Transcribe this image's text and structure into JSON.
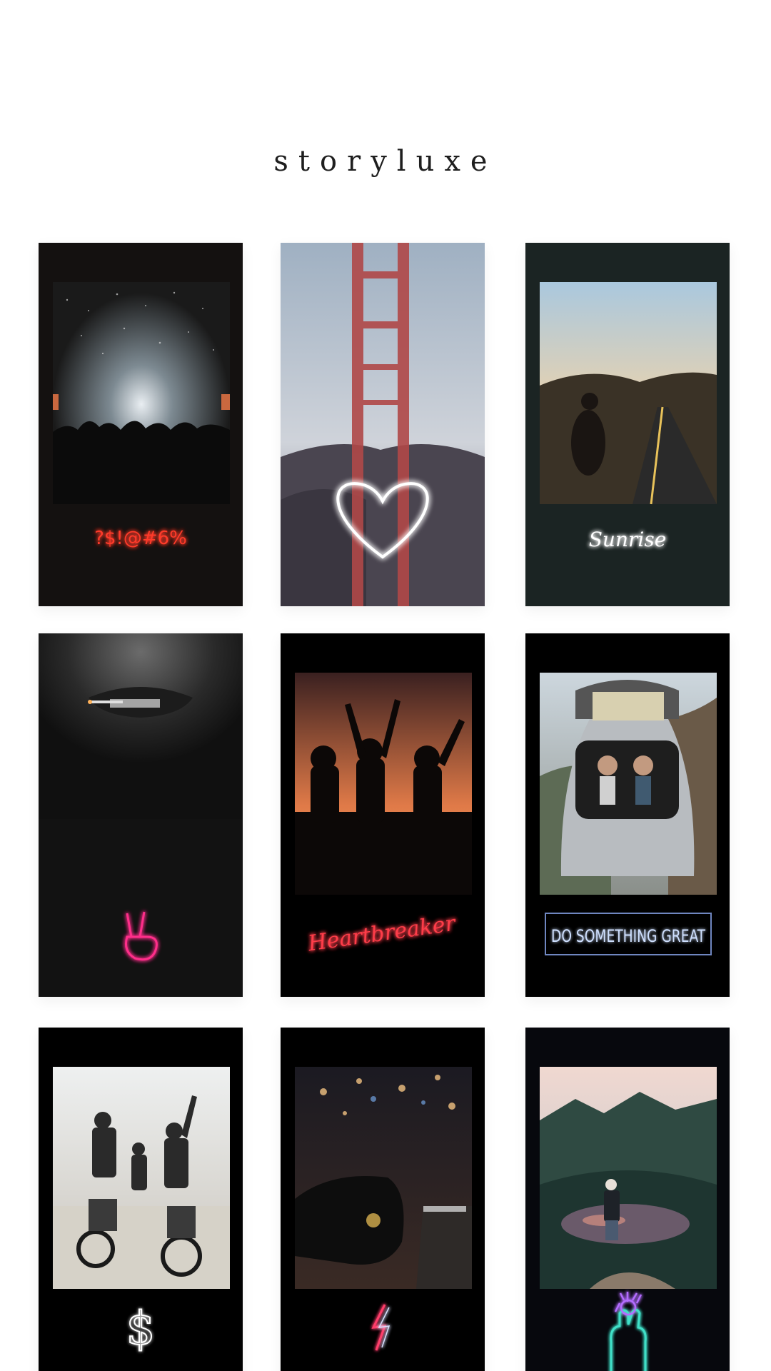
{
  "brand": {
    "name": "storyluxe"
  },
  "templates": [
    {
      "id": "concert",
      "neon_text": "?$!@#6%",
      "neon_color": "#ff3a2a"
    },
    {
      "id": "bridge",
      "neon_symbol": "heart-icon",
      "neon_color": "#ffffff"
    },
    {
      "id": "road",
      "neon_text": "Sunrise",
      "neon_color": "#ffffff"
    },
    {
      "id": "portrait",
      "neon_symbol": "peace-hand-icon",
      "neon_color": "#ff2f8a"
    },
    {
      "id": "dancers",
      "neon_text": "Heartbreaker",
      "neon_color": "#ff3d4a"
    },
    {
      "id": "car-trunk",
      "neon_text": "DO SOMETHING GREAT",
      "neon_color": "#cfe0ff"
    },
    {
      "id": "bikers",
      "neon_symbol": "dollar-icon",
      "neon_color": "#ffffff"
    },
    {
      "id": "night-car",
      "neon_symbol": "lightning-icon",
      "neon_color": "#ff3d6a"
    },
    {
      "id": "mountain-lake",
      "neon_symbol": "hand-icon",
      "neon_color": "#3fe0c8"
    }
  ]
}
